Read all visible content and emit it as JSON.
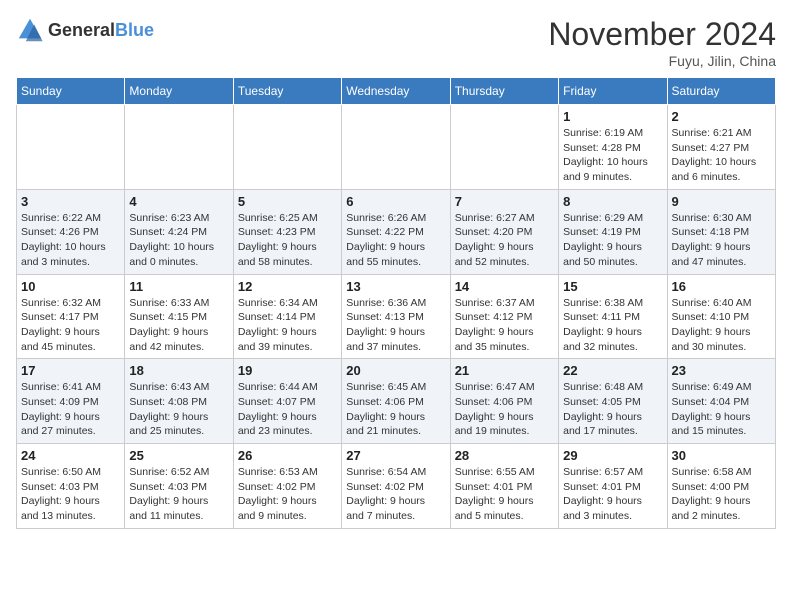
{
  "header": {
    "logo_general": "General",
    "logo_blue": "Blue",
    "month_title": "November 2024",
    "location": "Fuyu, Jilin, China"
  },
  "weekdays": [
    "Sunday",
    "Monday",
    "Tuesday",
    "Wednesday",
    "Thursday",
    "Friday",
    "Saturday"
  ],
  "weeks": [
    [
      {
        "day": "",
        "info": ""
      },
      {
        "day": "",
        "info": ""
      },
      {
        "day": "",
        "info": ""
      },
      {
        "day": "",
        "info": ""
      },
      {
        "day": "",
        "info": ""
      },
      {
        "day": "1",
        "info": "Sunrise: 6:19 AM\nSunset: 4:28 PM\nDaylight: 10 hours\nand 9 minutes."
      },
      {
        "day": "2",
        "info": "Sunrise: 6:21 AM\nSunset: 4:27 PM\nDaylight: 10 hours\nand 6 minutes."
      }
    ],
    [
      {
        "day": "3",
        "info": "Sunrise: 6:22 AM\nSunset: 4:26 PM\nDaylight: 10 hours\nand 3 minutes."
      },
      {
        "day": "4",
        "info": "Sunrise: 6:23 AM\nSunset: 4:24 PM\nDaylight: 10 hours\nand 0 minutes."
      },
      {
        "day": "5",
        "info": "Sunrise: 6:25 AM\nSunset: 4:23 PM\nDaylight: 9 hours\nand 58 minutes."
      },
      {
        "day": "6",
        "info": "Sunrise: 6:26 AM\nSunset: 4:22 PM\nDaylight: 9 hours\nand 55 minutes."
      },
      {
        "day": "7",
        "info": "Sunrise: 6:27 AM\nSunset: 4:20 PM\nDaylight: 9 hours\nand 52 minutes."
      },
      {
        "day": "8",
        "info": "Sunrise: 6:29 AM\nSunset: 4:19 PM\nDaylight: 9 hours\nand 50 minutes."
      },
      {
        "day": "9",
        "info": "Sunrise: 6:30 AM\nSunset: 4:18 PM\nDaylight: 9 hours\nand 47 minutes."
      }
    ],
    [
      {
        "day": "10",
        "info": "Sunrise: 6:32 AM\nSunset: 4:17 PM\nDaylight: 9 hours\nand 45 minutes."
      },
      {
        "day": "11",
        "info": "Sunrise: 6:33 AM\nSunset: 4:15 PM\nDaylight: 9 hours\nand 42 minutes."
      },
      {
        "day": "12",
        "info": "Sunrise: 6:34 AM\nSunset: 4:14 PM\nDaylight: 9 hours\nand 39 minutes."
      },
      {
        "day": "13",
        "info": "Sunrise: 6:36 AM\nSunset: 4:13 PM\nDaylight: 9 hours\nand 37 minutes."
      },
      {
        "day": "14",
        "info": "Sunrise: 6:37 AM\nSunset: 4:12 PM\nDaylight: 9 hours\nand 35 minutes."
      },
      {
        "day": "15",
        "info": "Sunrise: 6:38 AM\nSunset: 4:11 PM\nDaylight: 9 hours\nand 32 minutes."
      },
      {
        "day": "16",
        "info": "Sunrise: 6:40 AM\nSunset: 4:10 PM\nDaylight: 9 hours\nand 30 minutes."
      }
    ],
    [
      {
        "day": "17",
        "info": "Sunrise: 6:41 AM\nSunset: 4:09 PM\nDaylight: 9 hours\nand 27 minutes."
      },
      {
        "day": "18",
        "info": "Sunrise: 6:43 AM\nSunset: 4:08 PM\nDaylight: 9 hours\nand 25 minutes."
      },
      {
        "day": "19",
        "info": "Sunrise: 6:44 AM\nSunset: 4:07 PM\nDaylight: 9 hours\nand 23 minutes."
      },
      {
        "day": "20",
        "info": "Sunrise: 6:45 AM\nSunset: 4:06 PM\nDaylight: 9 hours\nand 21 minutes."
      },
      {
        "day": "21",
        "info": "Sunrise: 6:47 AM\nSunset: 4:06 PM\nDaylight: 9 hours\nand 19 minutes."
      },
      {
        "day": "22",
        "info": "Sunrise: 6:48 AM\nSunset: 4:05 PM\nDaylight: 9 hours\nand 17 minutes."
      },
      {
        "day": "23",
        "info": "Sunrise: 6:49 AM\nSunset: 4:04 PM\nDaylight: 9 hours\nand 15 minutes."
      }
    ],
    [
      {
        "day": "24",
        "info": "Sunrise: 6:50 AM\nSunset: 4:03 PM\nDaylight: 9 hours\nand 13 minutes."
      },
      {
        "day": "25",
        "info": "Sunrise: 6:52 AM\nSunset: 4:03 PM\nDaylight: 9 hours\nand 11 minutes."
      },
      {
        "day": "26",
        "info": "Sunrise: 6:53 AM\nSunset: 4:02 PM\nDaylight: 9 hours\nand 9 minutes."
      },
      {
        "day": "27",
        "info": "Sunrise: 6:54 AM\nSunset: 4:02 PM\nDaylight: 9 hours\nand 7 minutes."
      },
      {
        "day": "28",
        "info": "Sunrise: 6:55 AM\nSunset: 4:01 PM\nDaylight: 9 hours\nand 5 minutes."
      },
      {
        "day": "29",
        "info": "Sunrise: 6:57 AM\nSunset: 4:01 PM\nDaylight: 9 hours\nand 3 minutes."
      },
      {
        "day": "30",
        "info": "Sunrise: 6:58 AM\nSunset: 4:00 PM\nDaylight: 9 hours\nand 2 minutes."
      }
    ]
  ]
}
